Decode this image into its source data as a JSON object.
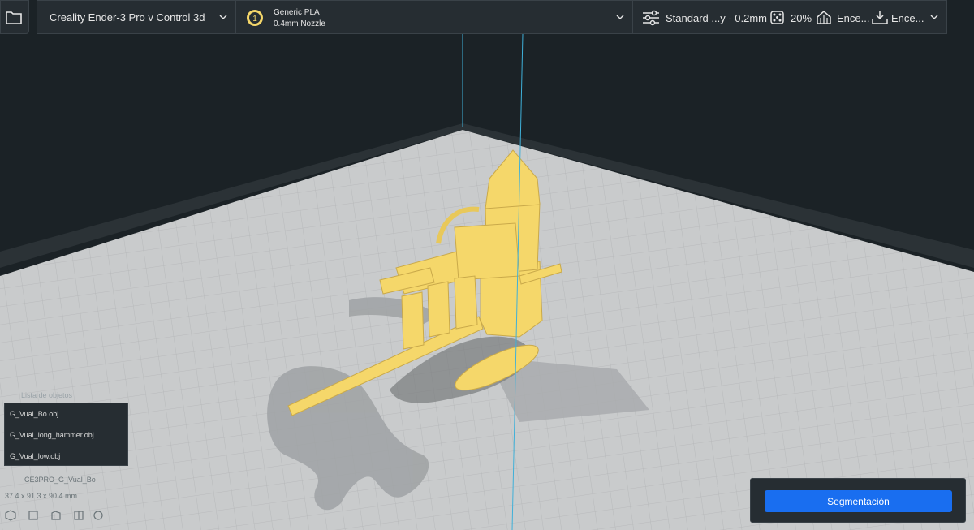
{
  "toolbar": {
    "open_icon": "folder-icon",
    "printer": {
      "name": "Creality Ender-3 Pro v Control 3d",
      "icon": "chevron-down-icon"
    },
    "material": {
      "extruder_index": "1",
      "material_name": "Generic PLA",
      "nozzle": "0.4mm Nozzle",
      "icon": "chevron-down-icon"
    },
    "settings": {
      "profile": "Standard ...y - 0.2mm",
      "infill": "20%",
      "support": "Ence...",
      "adhesion": "Ence..."
    }
  },
  "object_list": {
    "title": "Lista de objetos",
    "items": [
      "G_Vual_Bo.obj",
      "G_Vual_long_hammer.obj",
      "G_Vual_low.obj"
    ],
    "selected_name": "CE3PRO_G_Vual_Bo",
    "dimensions": "37.4 x 91.3 x 90.4 mm"
  },
  "action": {
    "segment_label": "Segmentación"
  },
  "colors": {
    "accent": "#196ef0",
    "model": "#f5d76a",
    "plate": "#c9cbcc",
    "background": "#1b2226",
    "panel": "#262d32"
  }
}
